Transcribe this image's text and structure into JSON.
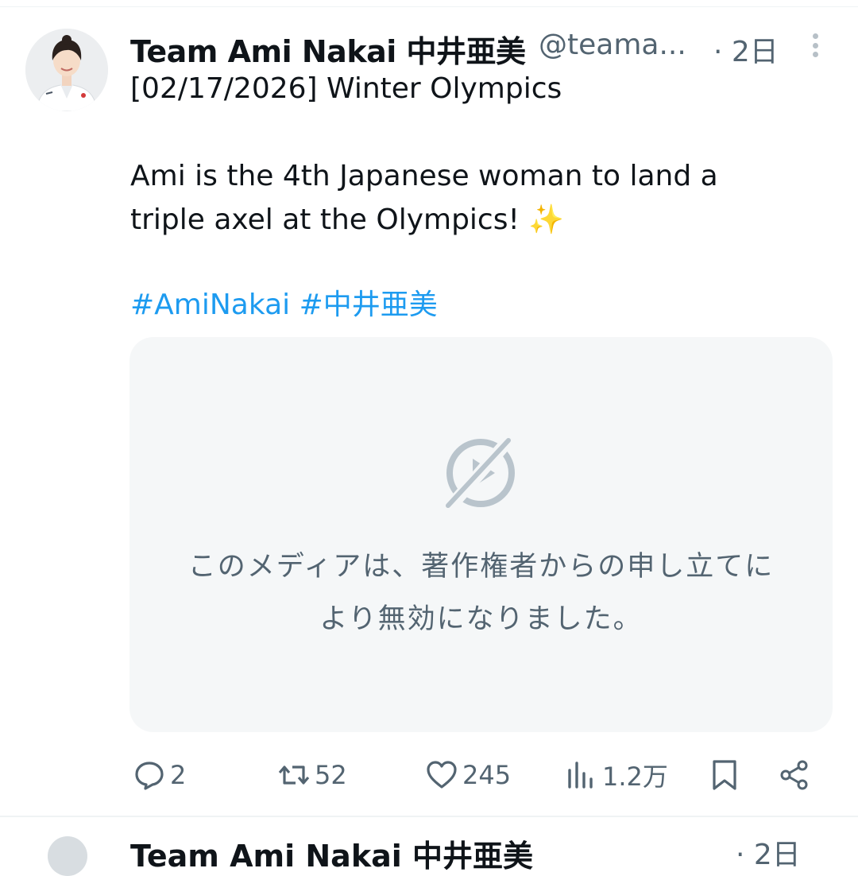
{
  "tweet": {
    "author": {
      "display_name": "Team Ami Nakai 中井亜美",
      "handle": "@teama...",
      "time": "· 2日",
      "avatar": "profile-photo"
    },
    "text": "[02/17/2026] Winter Olympics\n\nAmi is the 4th Japanese woman to land a\ntriple axel at the Olympics! ✨",
    "hashtags": [
      "#AmiNakai",
      "#中井亜美"
    ],
    "media": {
      "icon": "video-unavailable-icon",
      "message": "このメディアは、著作権者からの申し立てに\nより無効になりました。"
    },
    "actions": {
      "replies": "2",
      "reposts": "52",
      "likes": "245",
      "views": "1.2万"
    }
  },
  "next_tweet": {
    "display_name": "Team Ami Nakai 中井亜美",
    "time": "· 2日"
  },
  "colors": {
    "hashtag": "#1d9bf0",
    "secondary_text": "#536471",
    "media_background": "#f5f7f8",
    "media_icon": "#b9c4cc"
  }
}
